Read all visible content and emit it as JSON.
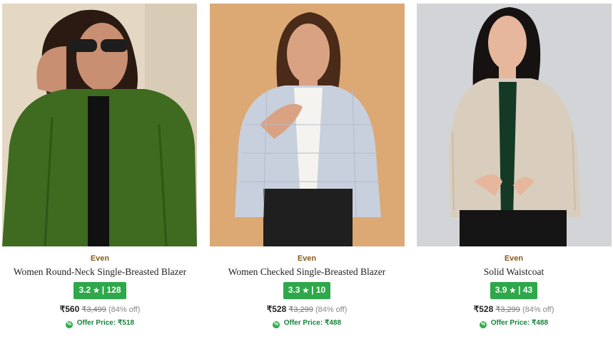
{
  "products": [
    {
      "brand": "Even",
      "title": "Women Round-Neck Single-Breasted Blazer",
      "rating": "3.2",
      "rating_count": "128",
      "price": "₹560",
      "mrp": "₹3,499",
      "discount": "(84% off)",
      "offer_label": "Offer Price:",
      "offer_price": "₹518",
      "image_subject": "woman in green wool jacket with sunglasses",
      "colors": {
        "background": "#e4d8c4",
        "garment": "#3e6b1f",
        "hair": "#2a1a12"
      }
    },
    {
      "brand": "Even",
      "title": "Women Checked Single-Breasted Blazer",
      "rating": "3.3",
      "rating_count": "10",
      "price": "₹528",
      "mrp": "₹3,299",
      "discount": "(84% off)",
      "offer_label": "Offer Price:",
      "offer_price": "₹488",
      "image_subject": "woman in light blue checked blazer",
      "colors": {
        "background": "#dca874",
        "garment": "#c7d0dc",
        "hair": "#4a2a18"
      }
    },
    {
      "brand": "Even",
      "title": "Solid Waistcoat",
      "rating": "3.9",
      "rating_count": "43",
      "price": "₹528",
      "mrp": "₹3,299",
      "discount": "(84% off)",
      "offer_label": "Offer Price:",
      "offer_price": "₹488",
      "image_subject": "woman in beige collarless jacket",
      "colors": {
        "background": "#d3d4d8",
        "garment": "#d9cdbd",
        "hair": "#161212"
      }
    }
  ],
  "icons": {
    "star": "star-icon",
    "offer": "offer-tag-icon"
  },
  "theme": {
    "rating_green": "#2ea84a",
    "offer_green": "#17843b",
    "brand_color": "#8a5a18"
  }
}
